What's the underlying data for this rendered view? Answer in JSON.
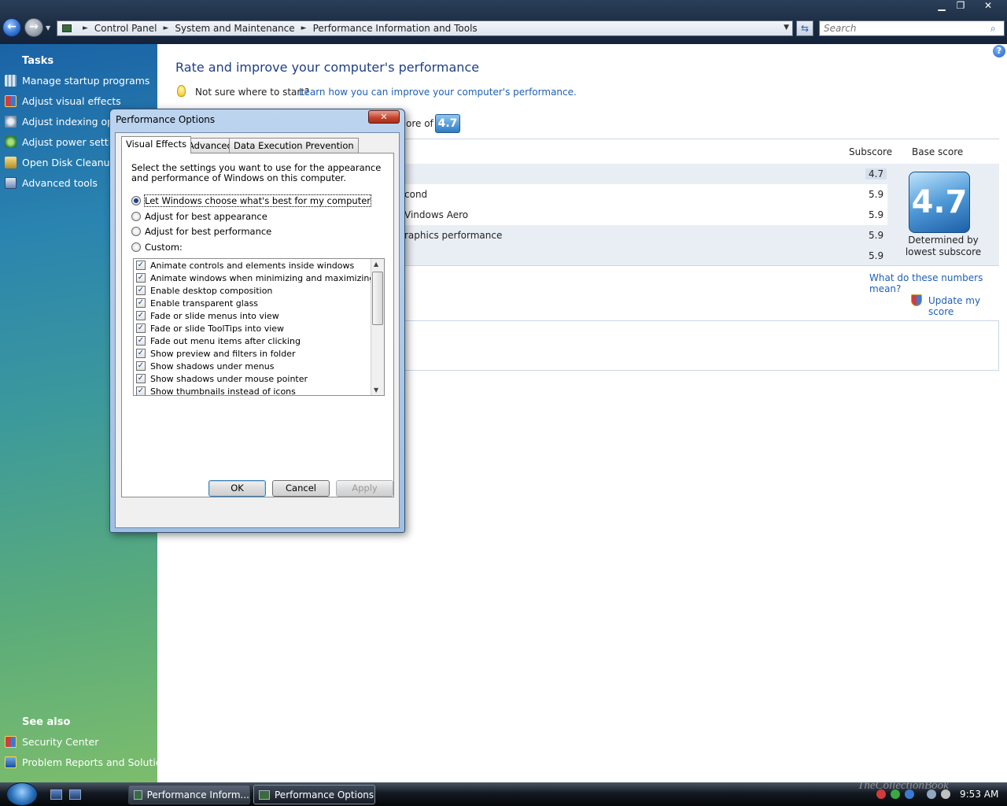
{
  "window": {
    "controls": {
      "minimize": "▁",
      "maximize": "❐",
      "close": "✕"
    },
    "address": {
      "crumbs": [
        "Control Panel",
        "System and Maintenance",
        "Performance Information and Tools"
      ],
      "sep": "►",
      "drop": "▼"
    },
    "nav": {
      "back": "←",
      "forward": "→",
      "drop": "▼",
      "refresh": "⇆"
    },
    "search": {
      "placeholder": "Search",
      "icon": "⌕"
    }
  },
  "sidebar": {
    "tasks_heading": "Tasks",
    "tasks": [
      {
        "label": "Manage startup programs",
        "icon": "startup-icon"
      },
      {
        "label": "Adjust visual effects",
        "icon": "shield-icon"
      },
      {
        "label": "Adjust indexing optio",
        "icon": "indexing-icon"
      },
      {
        "label": "Adjust power setting",
        "icon": "power-icon"
      },
      {
        "label": "Open Disk Cleanup",
        "icon": "disk-cleanup-icon"
      },
      {
        "label": "Advanced tools",
        "icon": "tools-icon"
      }
    ],
    "see_also_heading": "See also",
    "see_also": [
      {
        "label": "Security Center",
        "icon": "shield-icon"
      },
      {
        "label": "Problem Reports and Solutions",
        "icon": "problem-reports-icon"
      }
    ]
  },
  "main": {
    "help": "?",
    "title": "Rate and improve your computer's performance",
    "hint_text": "Not sure where to start?",
    "hint_link": "Learn how you can improve your computer's performance.",
    "score_prefix": "ore of",
    "score_badge": "4.7",
    "table": {
      "header_subscore": "Subscore",
      "header_basescore": "Base score",
      "rows": [
        {
          "label": "",
          "subscore": "4.7"
        },
        {
          "label": "cond",
          "subscore": "5.9"
        },
        {
          "label": "Vindows Aero",
          "subscore": "5.9"
        },
        {
          "label": "raphics performance",
          "subscore": "5.9"
        },
        {
          "label": "",
          "subscore": "5.9"
        }
      ],
      "base_score": "4.7",
      "determined_by": "Determined by lowest subscore"
    },
    "numbers_link": "What do these numbers mean?",
    "update_link": "Update my score"
  },
  "dialog": {
    "title": "Performance Options",
    "close": "✕",
    "tabs": [
      "Visual Effects",
      "Advanced",
      "Data Execution Prevention"
    ],
    "description": "Select the settings you want to use for the appearance and performance of Windows on this computer.",
    "radios": [
      {
        "label": "Let Windows choose what's best for my computer",
        "checked": true
      },
      {
        "label": "Adjust for best appearance",
        "checked": false
      },
      {
        "label": "Adjust for best performance",
        "checked": false
      },
      {
        "label": "Custom:",
        "checked": false
      }
    ],
    "checkboxes": [
      "Animate controls and elements inside windows",
      "Animate windows when minimizing and maximizing",
      "Enable desktop composition",
      "Enable transparent glass",
      "Fade or slide menus into view",
      "Fade or slide ToolTips into view",
      "Fade out menu items after clicking",
      "Show preview and filters in folder",
      "Show shadows under menus",
      "Show shadows under mouse pointer",
      "Show thumbnails instead of icons"
    ],
    "check_mark": "✓",
    "scroll_up": "▲",
    "scroll_down": "▼",
    "buttons": {
      "ok": "OK",
      "cancel": "Cancel",
      "apply": "Apply"
    }
  },
  "taskbar": {
    "buttons": [
      "Performance Inform...",
      "Performance Options"
    ],
    "watermark": "TheCollectionBook",
    "clock": "9:53 AM"
  }
}
